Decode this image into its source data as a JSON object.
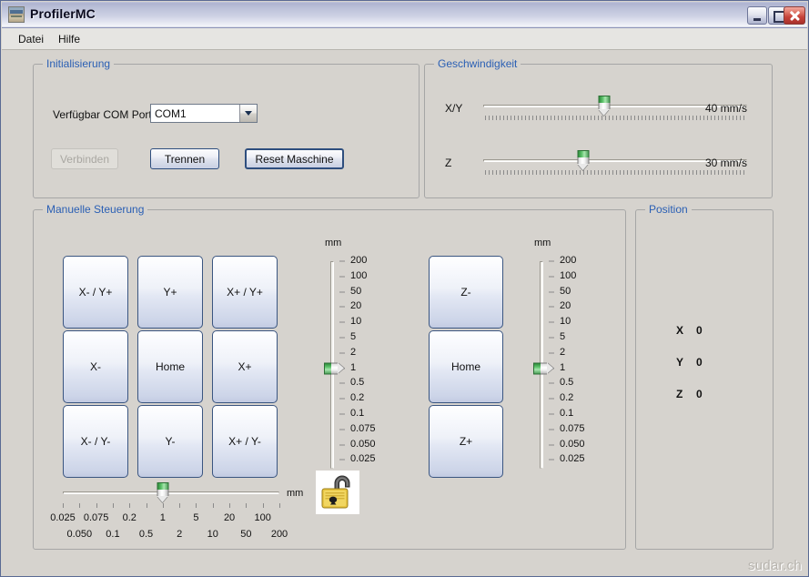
{
  "window": {
    "title": "ProfilerMC",
    "app_icon": "machine-photo-icon",
    "controls": {
      "minimize": "minimize-icon",
      "maximize": "maximize-icon",
      "close": "close-icon"
    }
  },
  "menubar": {
    "items": [
      {
        "label": "Datei"
      },
      {
        "label": "Hilfe"
      }
    ]
  },
  "init": {
    "caption": "Initialisierung",
    "com_label": "Verfügbar COM Ports",
    "com_value": "COM1",
    "com_options": [
      "COM1"
    ],
    "buttons": {
      "connect": "Verbinden",
      "disconnect": "Trennen",
      "reset": "Reset Maschine"
    }
  },
  "speed": {
    "caption": "Geschwindigkeit",
    "rows": [
      {
        "label": "X/Y",
        "value": "40 mm/s",
        "percent": 46
      },
      {
        "label": "Z",
        "value": "30 mm/s",
        "percent": 38
      }
    ]
  },
  "manual": {
    "caption": "Manuelle Steuerung",
    "jog_buttons": [
      "X- / Y+",
      "Y+",
      "X+ / Y+",
      "X-",
      "Home",
      "X+",
      "X- / Y-",
      "Y-",
      "X+ / Y-"
    ],
    "z_buttons": [
      "Z-",
      "Home",
      "Z+"
    ],
    "xy_scale": {
      "unit": "mm",
      "labels": [
        "200",
        "100",
        "50",
        "20",
        "10",
        "5",
        "2",
        "1",
        "0.5",
        "0.2",
        "0.1",
        "0.075",
        "0.050",
        "0.025"
      ],
      "selected": "1"
    },
    "z_scale": {
      "unit": "mm",
      "labels": [
        "200",
        "100",
        "50",
        "20",
        "10",
        "5",
        "2",
        "1",
        "0.5",
        "0.2",
        "0.1",
        "0.075",
        "0.050",
        "0.025"
      ],
      "selected": "1"
    },
    "step_slider": {
      "unit": "mm",
      "selected": "1",
      "selected_index": 6,
      "labels_top": [
        "0.025",
        "0.075",
        "0.2",
        "1",
        "5",
        "20",
        "100"
      ],
      "labels_bottom": [
        "0.050",
        "0.1",
        "0.5",
        "2",
        "10",
        "50",
        "200"
      ]
    },
    "lock_icon": "open-padlock-icon"
  },
  "position": {
    "caption": "Position",
    "rows": [
      {
        "axis": "X",
        "value": "0"
      },
      {
        "axis": "Y",
        "value": "0"
      },
      {
        "axis": "Z",
        "value": "0"
      }
    ]
  },
  "watermark": "sudar.ch",
  "colors": {
    "window_bg": "#d6d3ce",
    "group_caption": "#2a5fb4",
    "accent_green": "#4da15a",
    "close_red": "#c6423a",
    "lock_gold": "#e8c542"
  }
}
